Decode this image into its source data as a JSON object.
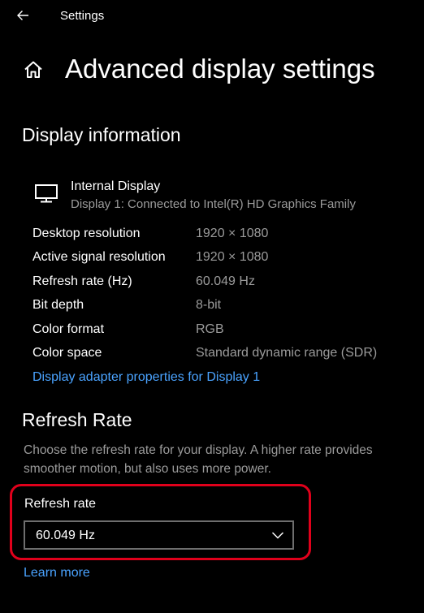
{
  "window": {
    "title": "Settings"
  },
  "page": {
    "title": "Advanced display settings"
  },
  "display_info": {
    "heading": "Display information",
    "display_name": "Internal Display",
    "display_subtitle": "Display 1: Connected to Intel(R) HD Graphics Family",
    "rows": [
      {
        "label": "Desktop resolution",
        "value": "1920 × 1080"
      },
      {
        "label": "Active signal resolution",
        "value": "1920 × 1080"
      },
      {
        "label": "Refresh rate (Hz)",
        "value": "60.049 Hz"
      },
      {
        "label": "Bit depth",
        "value": "8-bit"
      },
      {
        "label": "Color format",
        "value": "RGB"
      },
      {
        "label": "Color space",
        "value": "Standard dynamic range (SDR)"
      }
    ],
    "adapter_link": "Display adapter properties for Display 1"
  },
  "refresh_rate": {
    "heading": "Refresh Rate",
    "description": "Choose the refresh rate for your display. A higher rate provides smoother motion, but also uses more power.",
    "dropdown_label": "Refresh rate",
    "dropdown_value": "60.049 Hz",
    "learn_more": "Learn more"
  },
  "colors": {
    "accent_link": "#4aa3ff",
    "highlight": "#e0001b"
  }
}
